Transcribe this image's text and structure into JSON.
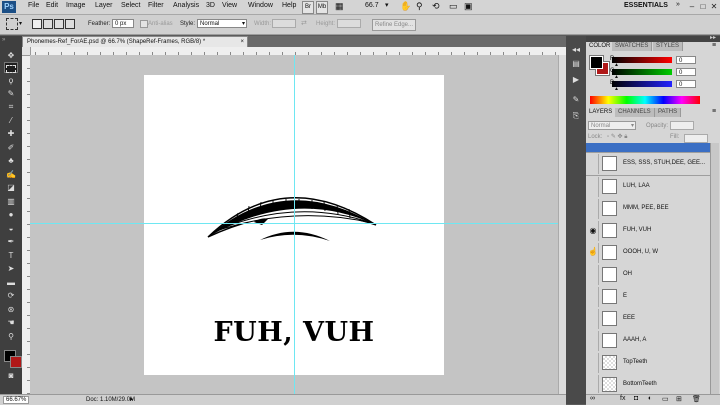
{
  "app": {
    "logo": "Ps",
    "workspace": "ESSENTIALS",
    "zoom_readout": "66.7",
    "menu": [
      "File",
      "Edit",
      "Image",
      "Layer",
      "Select",
      "Filter",
      "Analysis",
      "3D",
      "View",
      "Window",
      "Help"
    ],
    "window_controls": [
      "–",
      "□",
      "✕"
    ]
  },
  "options": {
    "feather_label": "Feather:",
    "feather_value": "0 px",
    "antialias_label": "Anti-alias",
    "style_label": "Style:",
    "style_value": "Normal",
    "width_label": "Width:",
    "height_label": "Height:",
    "refine_edge": "Refine Edge..."
  },
  "document": {
    "tab_title": "Phonemes-Ref_ForAE.psd @ 66.7% (ShapeRef-Frames, RGB/8) *",
    "phoneme_text": "FUH, VUH",
    "status_zoom": "66.67%",
    "status_doc": "Doc: 1.10M/29.0M"
  },
  "color_panel": {
    "tabs": [
      "COLOR",
      "SWATCHES",
      "STYLES"
    ],
    "channels": [
      {
        "label": "R",
        "value": "0",
        "color": "#c8141e"
      },
      {
        "label": "G",
        "value": "0",
        "color": "#1a9a2a"
      },
      {
        "label": "B",
        "value": "0",
        "color": "#1f3fd0"
      }
    ]
  },
  "layers_panel": {
    "tabs": [
      "LAYERS",
      "CHANNELS",
      "PATHS"
    ],
    "blend_mode": "Normal",
    "opacity_label": "Opacity:",
    "lock_label": "Lock:",
    "fill_label": "Fill:",
    "layers": [
      {
        "name": "ESS, SSS, STUH,DEE, GEE..."
      },
      {
        "name": "LUH, LAA"
      },
      {
        "name": "MMM, PEE, BEE"
      },
      {
        "name": "FUH, VUH"
      },
      {
        "name": "OOOH, U, W"
      },
      {
        "name": "OH"
      },
      {
        "name": "E"
      },
      {
        "name": "EEE"
      },
      {
        "name": "AAAH, A"
      },
      {
        "name": "TopTeeth"
      },
      {
        "name": "BottomTeeth"
      }
    ]
  }
}
